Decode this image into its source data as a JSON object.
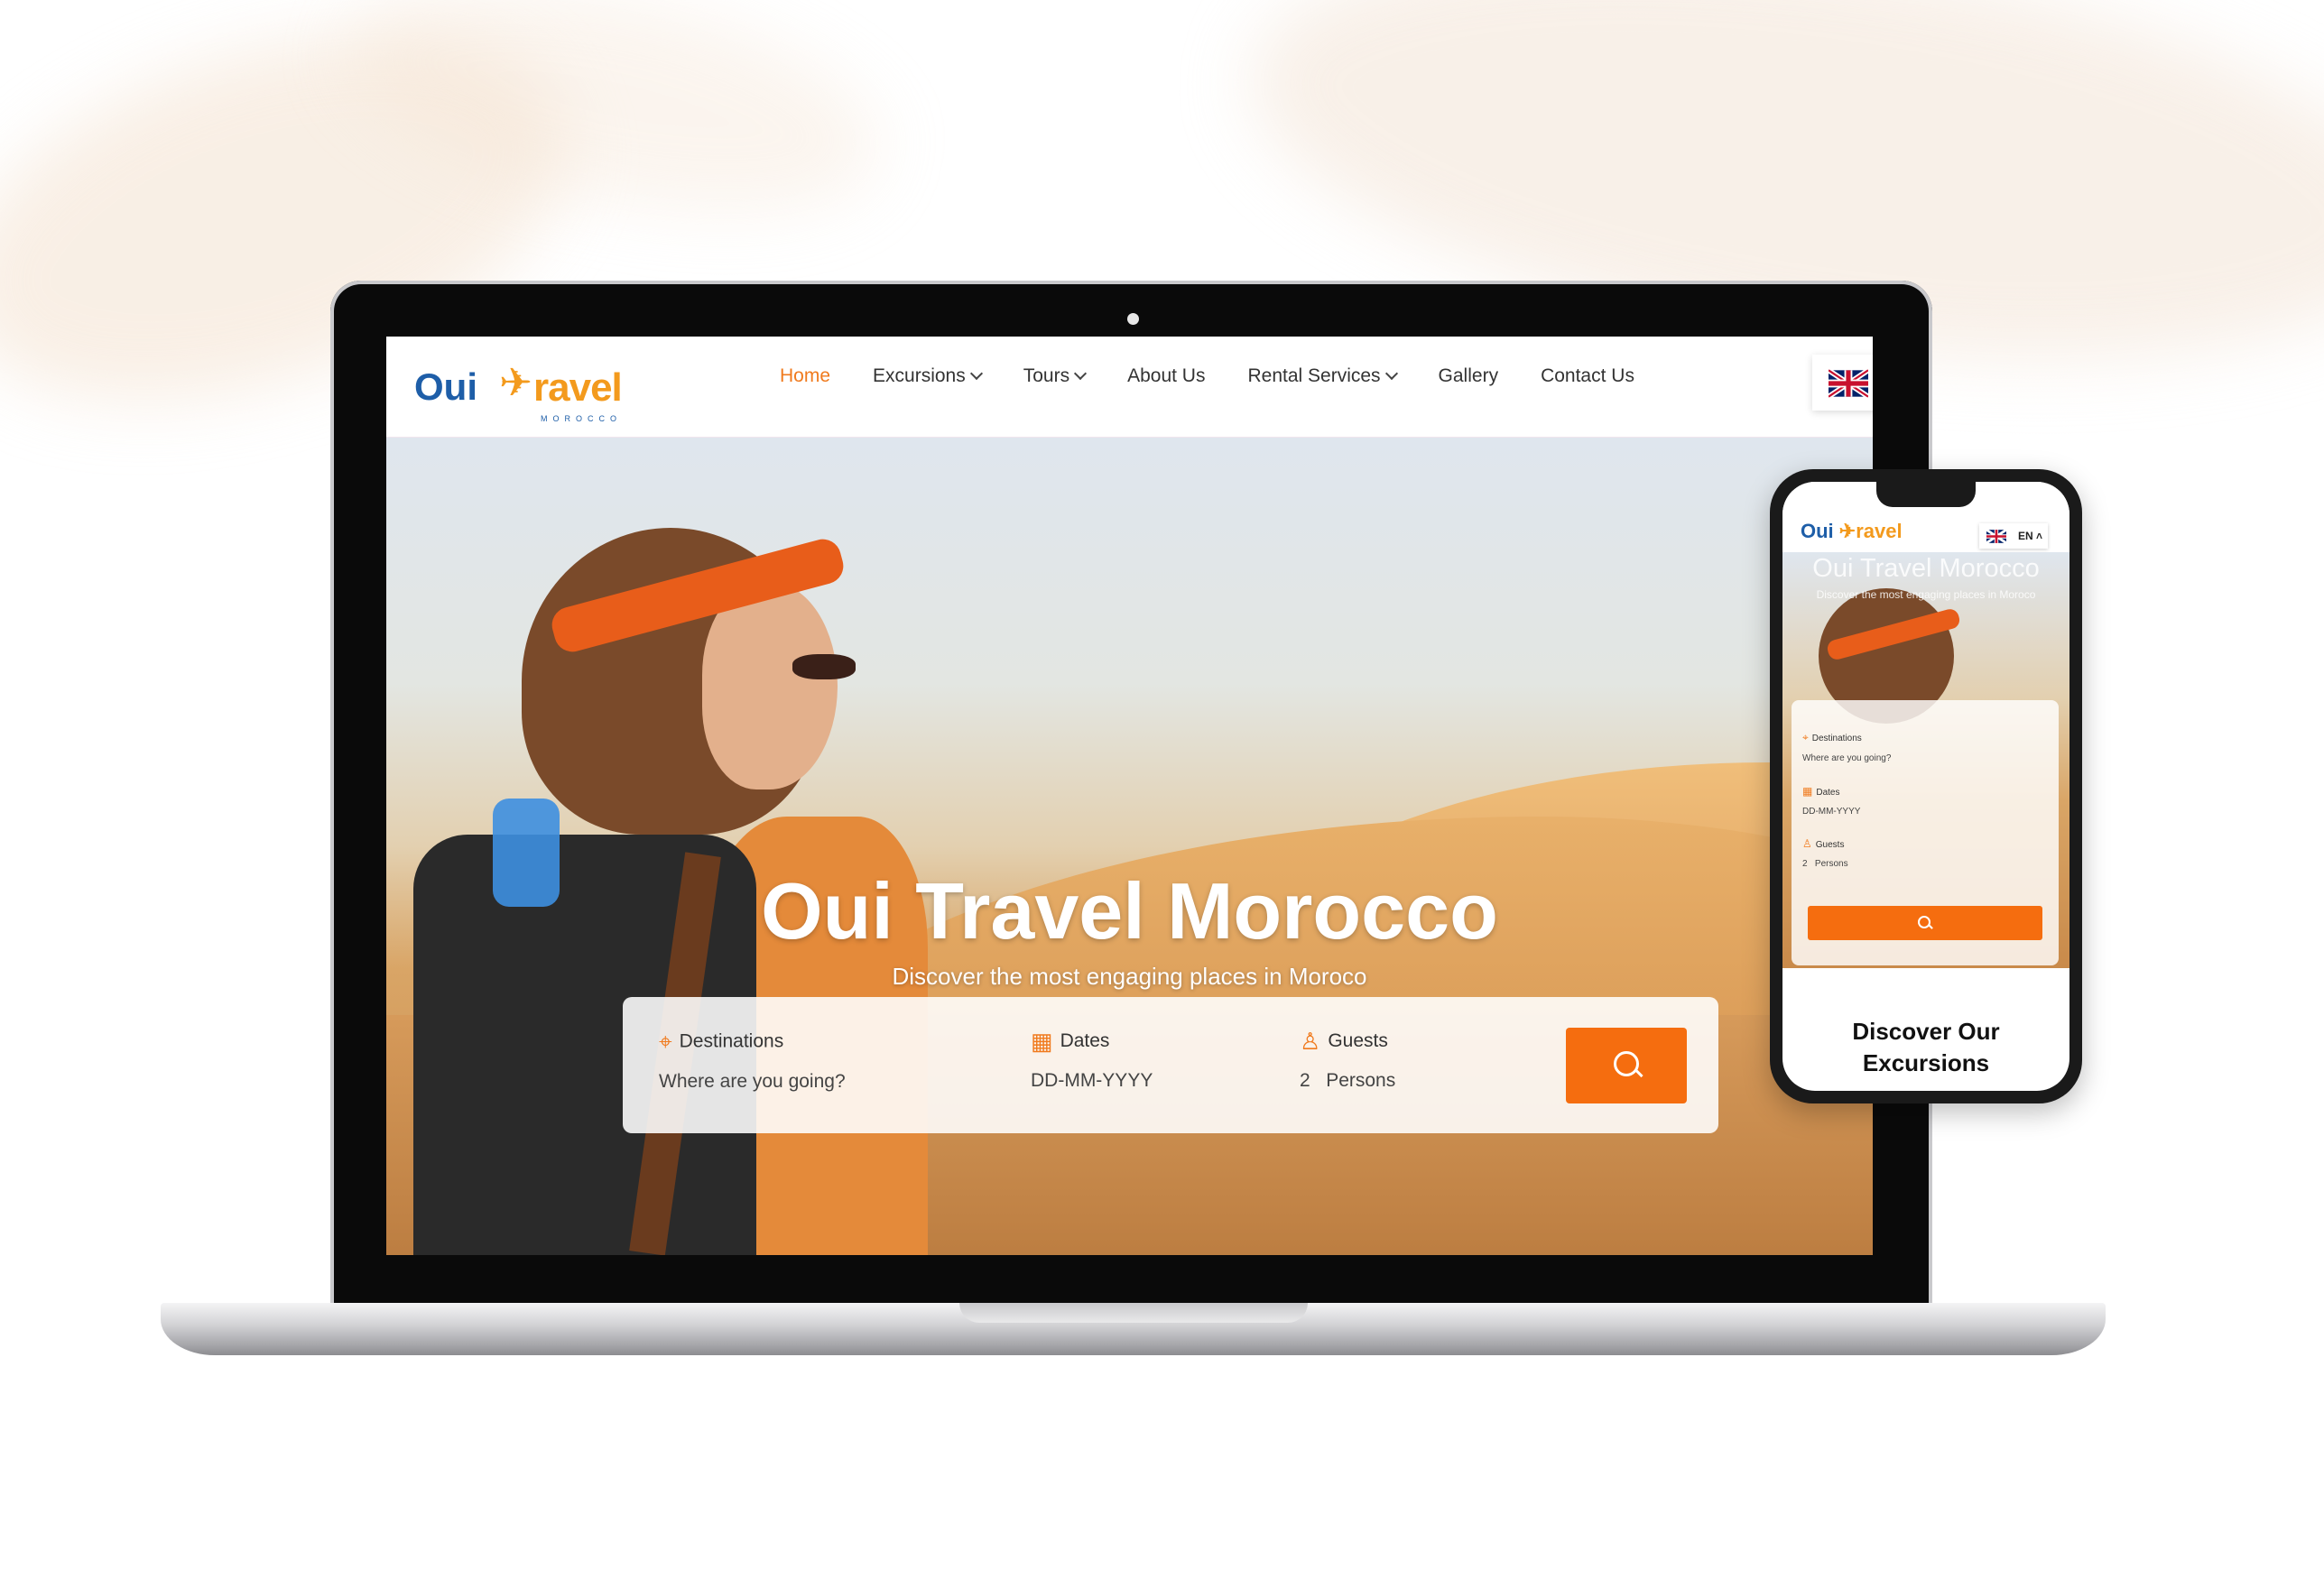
{
  "brand": {
    "logo_prefix": "Oui",
    "logo_suffix": "ravel",
    "logo_tagline": "MOROCCO",
    "accent_color": "#f07a1d",
    "brand_blue": "#1e5ea8"
  },
  "nav": {
    "items": [
      {
        "label": "Home",
        "active": true,
        "dropdown": false
      },
      {
        "label": "Excursions",
        "active": false,
        "dropdown": true
      },
      {
        "label": "Tours",
        "active": false,
        "dropdown": true
      },
      {
        "label": "About Us",
        "active": false,
        "dropdown": false
      },
      {
        "label": "Rental Services",
        "active": false,
        "dropdown": true
      },
      {
        "label": "Gallery",
        "active": false,
        "dropdown": false
      },
      {
        "label": "Contact Us",
        "active": false,
        "dropdown": false
      }
    ],
    "language_icon": "uk-flag-icon"
  },
  "hero": {
    "title": "Oui Travel Morocco",
    "subtitle": "Discover the most engaging places in Moroco"
  },
  "search": {
    "destinations_label": "Destinations",
    "destinations_placeholder": "Where are you going?",
    "dates_label": "Dates",
    "dates_value": "DD-MM-YYYY",
    "guests_label": "Guests",
    "guests_count": "2",
    "guests_unit": "Persons",
    "button_icon": "search-icon"
  },
  "mobile": {
    "logo_prefix": "Oui",
    "logo_suffix": "ravel",
    "lang_label": "EN",
    "hero_title": "Oui Travel Morocco",
    "hero_subtitle": "Discover the most engaging places in Moroco",
    "destinations_label": "Destinations",
    "destinations_placeholder": "Where are you going?",
    "dates_label": "Dates",
    "dates_value": "DD-MM-YYYY",
    "guests_label": "Guests",
    "guests_value": "2   Persons",
    "section_heading_line1": "Discover Our",
    "section_heading_line2": "Excursions"
  }
}
